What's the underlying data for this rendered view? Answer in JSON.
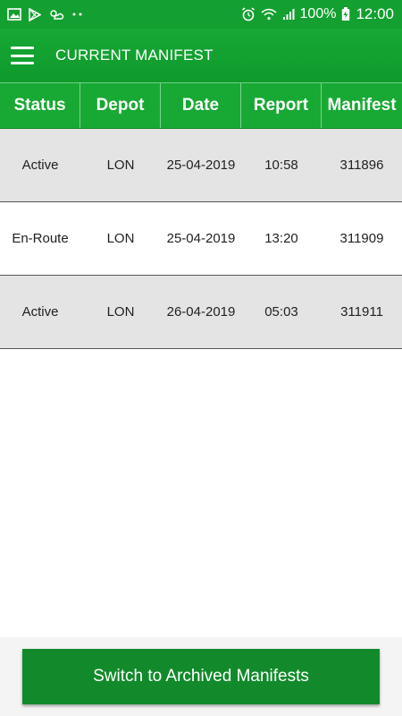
{
  "status_bar": {
    "battery_percent": "100%",
    "time": "12:00",
    "icons_left": [
      "image-icon",
      "play-store-icon",
      "weather-icon",
      "more-dots-icon"
    ],
    "icons_right": [
      "alarm-icon",
      "wifi-icon",
      "signal-icon",
      "battery-charging-icon"
    ]
  },
  "app_bar": {
    "title": "CURRENT MANIFEST",
    "menu_icon": "hamburger-menu-icon"
  },
  "table": {
    "columns": [
      "Status",
      "Depot",
      "Date",
      "Report",
      "Manifest"
    ],
    "rows": [
      {
        "status": "Active",
        "depot": "LON",
        "date": "25-04-2019",
        "report": "10:58",
        "manifest": "311896"
      },
      {
        "status": "En-Route",
        "depot": "LON",
        "date": "25-04-2019",
        "report": "13:20",
        "manifest": "311909"
      },
      {
        "status": "Active",
        "depot": "LON",
        "date": "26-04-2019",
        "report": "05:03",
        "manifest": "311911"
      }
    ]
  },
  "footer": {
    "archive_button_label": "Switch to Archived Manifests"
  },
  "colors": {
    "primary_green": "#13a030",
    "header_green": "#18a934",
    "button_green": "#128a2b",
    "row_shade": "#e4e4e4"
  }
}
